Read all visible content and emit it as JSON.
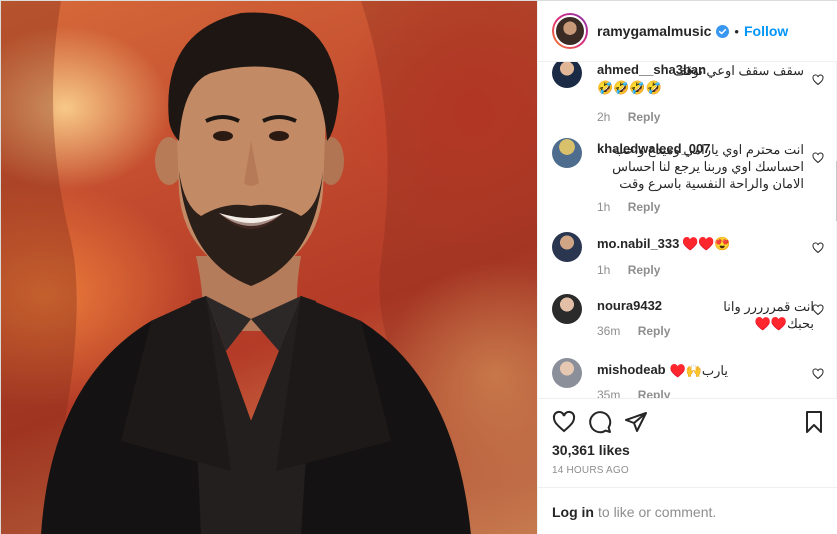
{
  "post": {
    "username": "ramygamalmusic",
    "follow_label": "Follow",
    "separator": "•",
    "likes": "30,361 likes",
    "time_ago": "14 HOURS AGO"
  },
  "comments": [
    {
      "user": "ahmed__sha3ban",
      "text": "سقف سقف اوعي توقف",
      "emoji": "🤣🤣🤣🤣",
      "time": "2h",
      "reply": "Reply"
    },
    {
      "user": "khaledwaleed_007",
      "text": "انت محترم اوي يارامي وميدع واحب احساسك اوي وربنا يرجع لنا احساس الامان والراحة النفسية باسرع وقت",
      "time": "1h",
      "reply": "Reply"
    },
    {
      "user": "mo.nabil_333",
      "text": "♥️♥️😍",
      "time": "1h",
      "reply": "Reply"
    },
    {
      "user": "noura9432",
      "text": "انت قمررررر وانا بحبك♥️♥️",
      "time": "36m",
      "reply": "Reply"
    },
    {
      "user": "mishodeab",
      "text": "يارب🙌♥️",
      "time": "35m",
      "reply": "Reply"
    }
  ],
  "login": {
    "link": "Log in",
    "rest": "to like or comment."
  },
  "colors": {
    "accent": "#0095f6",
    "muted": "#8e8e8e",
    "border": "#efefef"
  }
}
